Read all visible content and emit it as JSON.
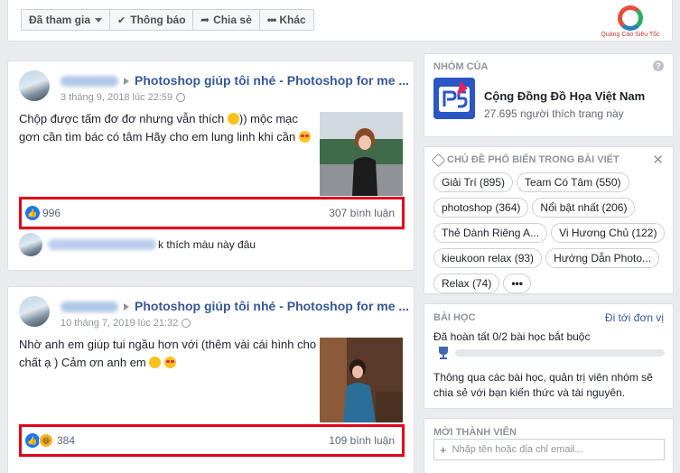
{
  "toolbar": {
    "joined_label": "Đã tham gia",
    "notify_label": "Thông báo",
    "share_label": "Chia sẻ",
    "more_label": "Khác"
  },
  "logo": {
    "caption": "Quảng Cáo Siêu Tốc"
  },
  "posts": [
    {
      "group_name": "Photoshop giúp tôi nhé - Photoshop for me ...",
      "timestamp": "3 tháng 9, 2018 lúc 22:59",
      "text": "Chộp được tấm đơ đơ nhưng vẫn thích",
      "text_tail": ")) mộc mạc gơn cần tìm bác có tâm Hãy cho em lung linh khi cần",
      "likes": "996",
      "comments": "307 bình luận",
      "comment_preview": "k thích màu này đâu"
    },
    {
      "group_name": "Photoshop giúp tôi nhé - Photoshop for me ...",
      "timestamp": "10 tháng 7, 2019 lúc 21:32",
      "text": "Nhờ anh em giúp tui ngầu hơn với (thêm vài cái hình cho chất ạ ) Cảm ơn anh em",
      "likes": "384",
      "comments": "109 bình luận"
    }
  ],
  "sidebar": {
    "group_section": {
      "header": "NHÓM CỦA",
      "name": "Cộng Đồng Đồ Họa Việt Nam",
      "likes": "27.695 người thích trang này"
    },
    "topics": {
      "header": "CHỦ ĐỀ PHỔ BIẾN TRONG BÀI VIẾT",
      "items": [
        "Giải Trí (895)",
        "Team Có Tâm (550)",
        "photoshop (364)",
        "Nổi bật nhất (206)",
        "Thẻ Dành Riêng A...",
        "Vi Hương Chủ (122)",
        "kieukoon relax (93)",
        "Hướng Dẫn Photo...",
        "Relax (74)",
        "•••"
      ]
    },
    "lessons": {
      "header": "BÀI HỌC",
      "link": "Đi tới đơn vị",
      "progress_text": "Đã hoàn tất 0/2 bài học bắt buộc",
      "progress": 0.0,
      "description": "Thông qua các bài học, quản trị viên nhóm sẽ chia sẻ với bạn kiến thức và tài nguyên."
    },
    "invite": {
      "header": "MỜI THÀNH VIÊN",
      "placeholder": "Nhập tên hoặc địa chỉ email..."
    }
  },
  "colors": {
    "link": "#365899",
    "highlight": "#e0001b",
    "like": "#1877f2"
  }
}
